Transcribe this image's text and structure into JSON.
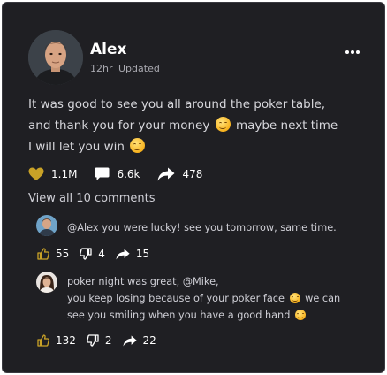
{
  "post": {
    "author": "Alex",
    "time": "12hr",
    "status": "Updated",
    "text_line1": "It was good to see you all around the poker table,",
    "text_line2a": "and thank you for your money",
    "text_line2b": "maybe next time",
    "text_line3": "I will let you win",
    "likes": "1.1M",
    "comments": "6.6k",
    "shares": "478",
    "view_all": "View all 10 comments",
    "icons": [
      "heart-icon",
      "comment-icon",
      "share-icon",
      "more-dots-icon",
      "smile-emoji-icon"
    ],
    "accent_color": "#c9a227"
  },
  "replies": [
    {
      "text": "@Alex you were lucky! see you tomorrow, same time.",
      "likes": "55",
      "dislikes": "4",
      "shares": "15"
    },
    {
      "line1": "poker night was great, @Mike,",
      "line2": "you keep losing because of your poker face",
      "line2b": "we can",
      "line3": "see you smiling when you have a good hand",
      "likes": "132",
      "dislikes": "2",
      "shares": "22"
    }
  ]
}
